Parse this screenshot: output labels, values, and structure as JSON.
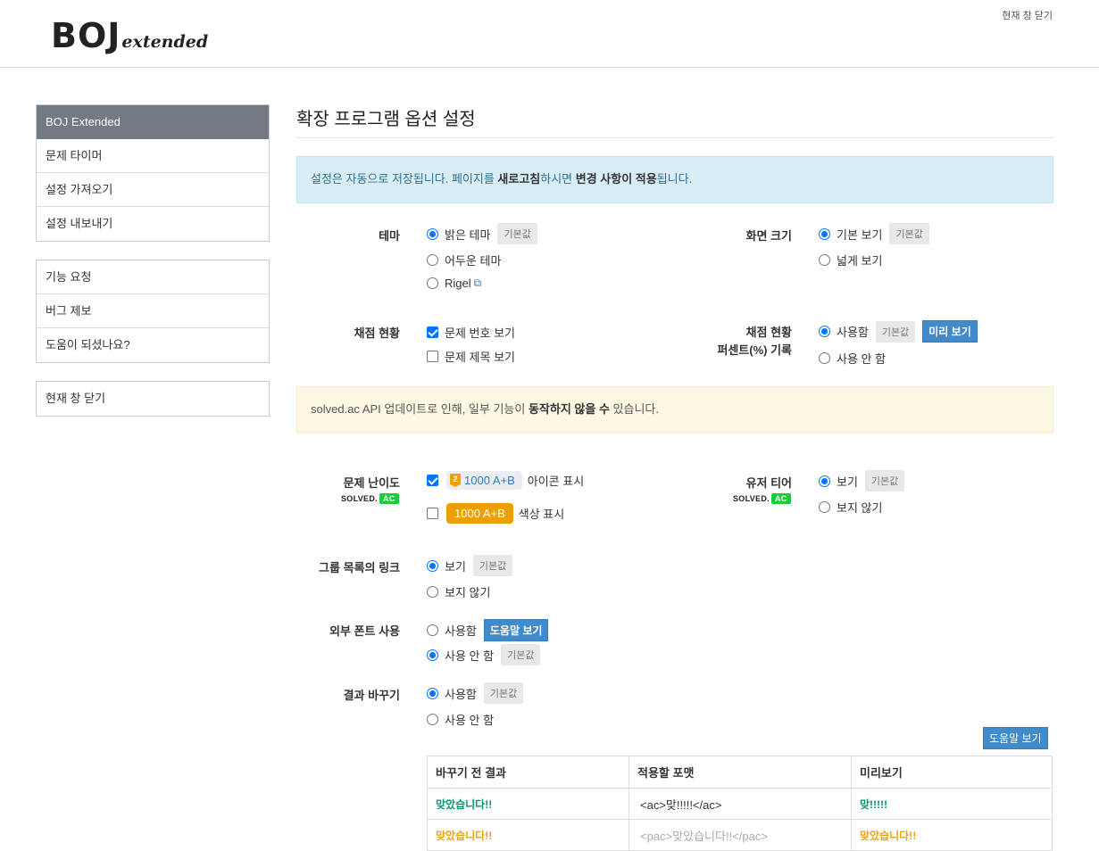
{
  "header": {
    "logo_main": "BOJ",
    "logo_ext": "extended",
    "close_link": "현재 창 닫기"
  },
  "sidebar": {
    "group1": [
      {
        "label": "BOJ Extended"
      },
      {
        "label": "문제 타이머"
      },
      {
        "label": "설정 가져오기"
      },
      {
        "label": "설정 내보내기"
      }
    ],
    "group2": [
      {
        "label": "기능 요청"
      },
      {
        "label": "버그 제보"
      },
      {
        "label": "도움이 되셨나요?"
      }
    ],
    "group3": [
      {
        "label": "현재 창 닫기"
      }
    ]
  },
  "main": {
    "title": "확장 프로그램 옵션 설정",
    "info": {
      "part1": "설정은 자동으로 저장됩니다. 페이지를 ",
      "bold1": "새로고침",
      "part2": "하시면 ",
      "bold2": "변경 사항이 적용",
      "part3": "됩니다."
    },
    "warning": {
      "part1": "solved.ac API 업데이트로 인해, 일부 기능이 ",
      "bold1": "동작하지 않을 수",
      "part2": " 있습니다."
    },
    "default_badge": "기본값",
    "theme": {
      "label": "테마",
      "options": [
        "밝은 테마",
        "어두운 테마",
        "Rigel"
      ],
      "selected": 0,
      "external_icon": "external-link-icon"
    },
    "screen_size": {
      "label": "화면 크기",
      "options": [
        "기본 보기",
        "넓게 보기"
      ],
      "selected": 0
    },
    "status": {
      "label": "채점 현황",
      "options": [
        "문제 번호 보기",
        "문제 제목 보기"
      ],
      "checked": [
        true,
        false
      ]
    },
    "status_percent": {
      "label1": "채점 현황",
      "label2": "퍼센트(%) 기록",
      "options": [
        "사용함",
        "사용 안 함"
      ],
      "selected": 0,
      "preview_button": "미리 보기"
    },
    "difficulty": {
      "label": "문제 난이도",
      "logo": "SOLVED.",
      "logo_ac": "AC",
      "tier_num": "2",
      "problem_pill": "1000 A+B",
      "icon_label": "아이콘 표시",
      "color_label": "색상 표시",
      "checked": [
        true,
        false
      ]
    },
    "user_tier": {
      "label": "유저 티어",
      "logo": "SOLVED.",
      "logo_ac": "AC",
      "options": [
        "보기",
        "보지 않기"
      ],
      "selected": 0
    },
    "group_link": {
      "label": "그룹 목록의 링크",
      "options": [
        "보기",
        "보지 않기"
      ],
      "selected": 0
    },
    "external_font": {
      "label": "외부 폰트 사용",
      "options": [
        "사용함",
        "사용 안 함"
      ],
      "selected": 1,
      "help_button": "도움말 보기"
    },
    "result_replace": {
      "label": "결과 바꾸기",
      "options": [
        "사용함",
        "사용 안 함"
      ],
      "selected": 0,
      "help_button": "도움말 보기",
      "table": {
        "headers": [
          "바꾸기 전 결과",
          "적용할 포맷",
          "미리보기"
        ],
        "rows": [
          {
            "before": "맞았습니다!!",
            "format": "<ac>맞!!!!!</ac>",
            "preview": "맞!!!!!",
            "style": "ac"
          },
          {
            "before": "맞았습니다!!",
            "format": "<pac>맞았습니다!!</pac>",
            "preview": "맞았습니다!!",
            "style": "pac"
          }
        ]
      }
    }
  },
  "colors": {
    "accent": "#0075ff",
    "sidebar_active": "#747a84",
    "info_bg": "#d9edf7",
    "warning_bg": "#fcf8e3",
    "ac_green": "#009874",
    "pac_orange": "#e8a317",
    "button_blue": "#428bca"
  }
}
